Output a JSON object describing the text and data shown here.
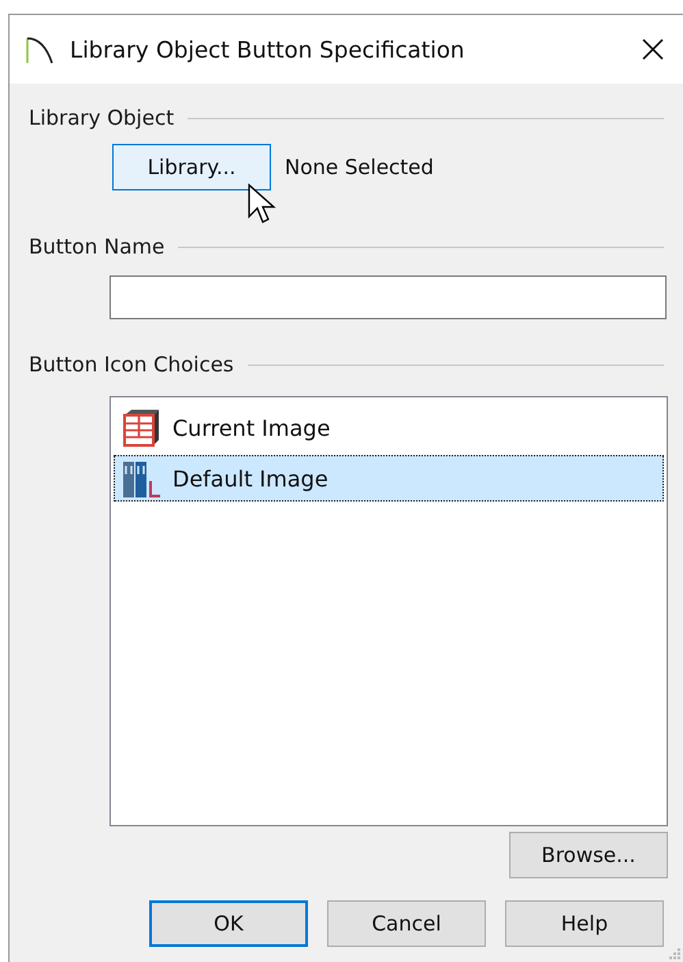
{
  "window": {
    "title": "Library Object Button Specification"
  },
  "library_object": {
    "label": "Library Object",
    "button": "Library...",
    "selection": "None Selected"
  },
  "button_name": {
    "label": "Button Name"
  },
  "icon_choices": {
    "label": "Button Icon Choices",
    "items": [
      {
        "label": "Current Image",
        "kind": "cabinet",
        "selected": false
      },
      {
        "label": "Default Image",
        "kind": "shelf",
        "selected": true
      }
    ],
    "browse": "Browse..."
  },
  "buttons": [
    {
      "label": "OK",
      "default": true
    },
    {
      "label": "Cancel",
      "default": false
    },
    {
      "label": "Help",
      "default": false
    }
  ]
}
